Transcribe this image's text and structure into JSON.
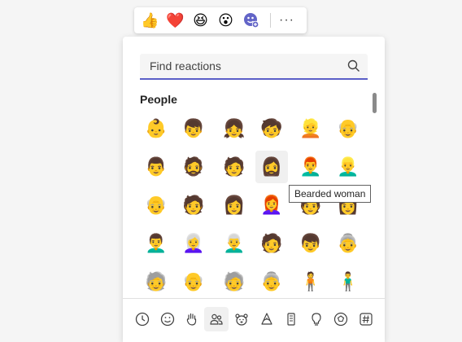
{
  "quick_reactions": [
    {
      "name": "like-icon",
      "glyph": "👍"
    },
    {
      "name": "heart-icon",
      "glyph": "❤️"
    },
    {
      "name": "laugh-icon",
      "glyph": "😆"
    },
    {
      "name": "surprised-icon",
      "glyph": "😮"
    },
    {
      "name": "add-reaction-icon",
      "glyph": "🫥"
    }
  ],
  "more_label": "···",
  "search": {
    "placeholder": "Find reactions"
  },
  "category": "People",
  "emoji_rows": [
    [
      "👶",
      "👦",
      "👧",
      "🧒",
      "👱",
      "👴"
    ],
    [
      "👨",
      "🧔",
      "🧑",
      "🧔‍♀️",
      "👨‍🦰",
      "👱‍♂️"
    ],
    [
      "👴",
      "🧑",
      "👩",
      "👩‍🦰",
      "🧑",
      "👩"
    ],
    [
      "👨‍🦱",
      "👩‍🦳",
      "👨‍🦳",
      "🧑",
      "👦",
      "👵"
    ],
    [
      "🧓",
      "👴",
      "🧓",
      "👵",
      "🧍",
      "🧍‍♂️"
    ]
  ],
  "hovered": {
    "row": 1,
    "col": 3
  },
  "tooltip": "Bearded woman",
  "category_tabs": [
    {
      "name": "recent-tab-icon"
    },
    {
      "name": "smileys-tab-icon"
    },
    {
      "name": "hand-gestures-tab-icon"
    },
    {
      "name": "people-tab-icon",
      "active": true
    },
    {
      "name": "animals-tab-icon"
    },
    {
      "name": "food-tab-icon"
    },
    {
      "name": "travel-tab-icon"
    },
    {
      "name": "objects-tab-icon"
    },
    {
      "name": "activities-tab-icon"
    },
    {
      "name": "symbols-tab-icon"
    }
  ],
  "colors": {
    "accent": "#5b5fc7"
  }
}
